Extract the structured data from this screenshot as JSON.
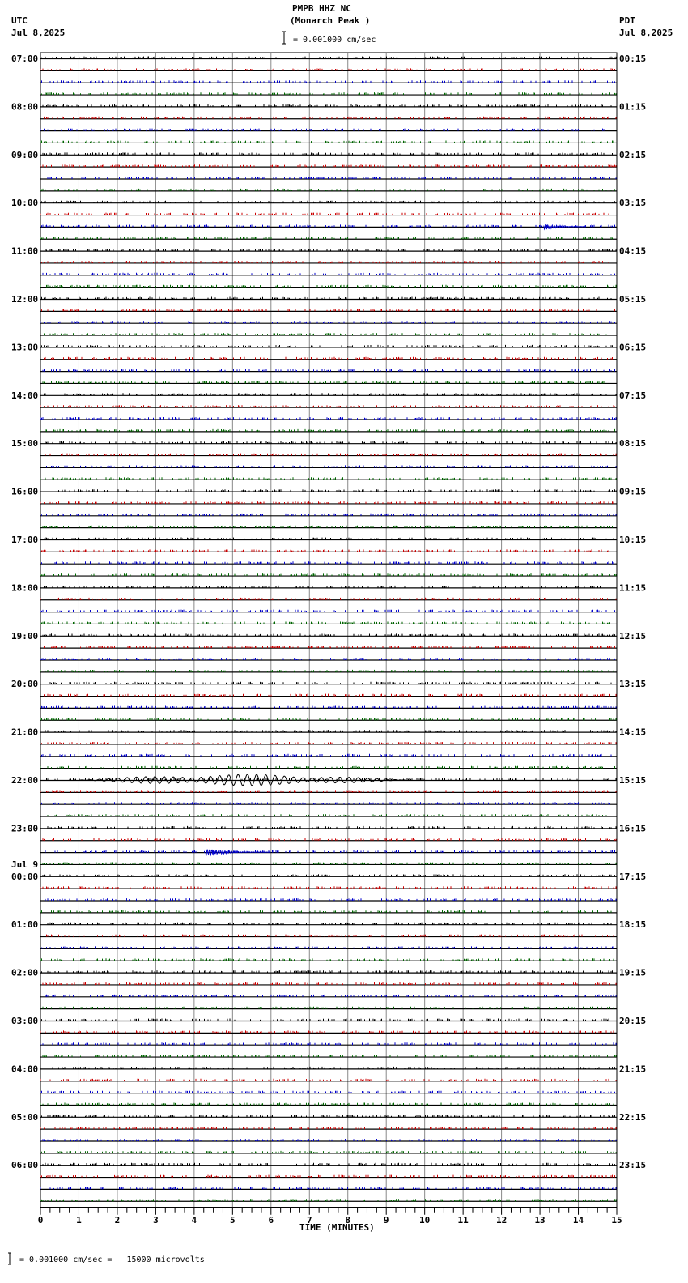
{
  "header": {
    "station": "PMPB HHZ NC",
    "location": "(Monarch Peak )",
    "left_tz": "UTC",
    "left_date": "Jul 8,2025",
    "right_tz": "PDT",
    "right_date": "Jul 8,2025",
    "scale_text": "= 0.001000 cm/sec"
  },
  "footer": {
    "scale_text": "= 0.001000 cm/sec =   15000 microvolts"
  },
  "chart_data": {
    "type": "line",
    "title": "PMPB HHZ NC (Monarch Peak )",
    "xlabel": "TIME (MINUTES)",
    "xlim": [
      0,
      15
    ],
    "x_ticks": [
      "0",
      "1",
      "2",
      "3",
      "4",
      "5",
      "6",
      "7",
      "8",
      "9",
      "10",
      "11",
      "12",
      "13",
      "14",
      "15"
    ],
    "traces_per_hour": 4,
    "trace_colors": [
      "#000000",
      "#cc0000",
      "#0000cc",
      "#006600"
    ],
    "date_change_label": "Jul 9",
    "left_labels": [
      "07:00",
      "08:00",
      "09:00",
      "10:00",
      "11:00",
      "12:00",
      "13:00",
      "14:00",
      "15:00",
      "16:00",
      "17:00",
      "18:00",
      "19:00",
      "20:00",
      "21:00",
      "22:00",
      "23:00",
      "00:00",
      "01:00",
      "02:00",
      "03:00",
      "04:00",
      "05:00",
      "06:00"
    ],
    "right_labels": [
      "00:15",
      "01:15",
      "02:15",
      "03:15",
      "04:15",
      "05:15",
      "06:15",
      "07:15",
      "08:15",
      "09:15",
      "10:15",
      "11:15",
      "12:15",
      "13:15",
      "14:15",
      "15:15",
      "16:15",
      "17:15",
      "18:15",
      "19:15",
      "20:15",
      "21:15",
      "22:15",
      "23:15"
    ],
    "events": [
      {
        "trace": 14,
        "start_min": 13.1,
        "end_min": 14.2,
        "amplitude": 5
      },
      {
        "trace": 60,
        "start_min": 1.0,
        "end_min": 9.5,
        "amplitude": 7,
        "type": "surface-wave"
      },
      {
        "trace": 66,
        "start_min": 4.3,
        "end_min": 6.0,
        "amplitude": 6
      }
    ]
  }
}
